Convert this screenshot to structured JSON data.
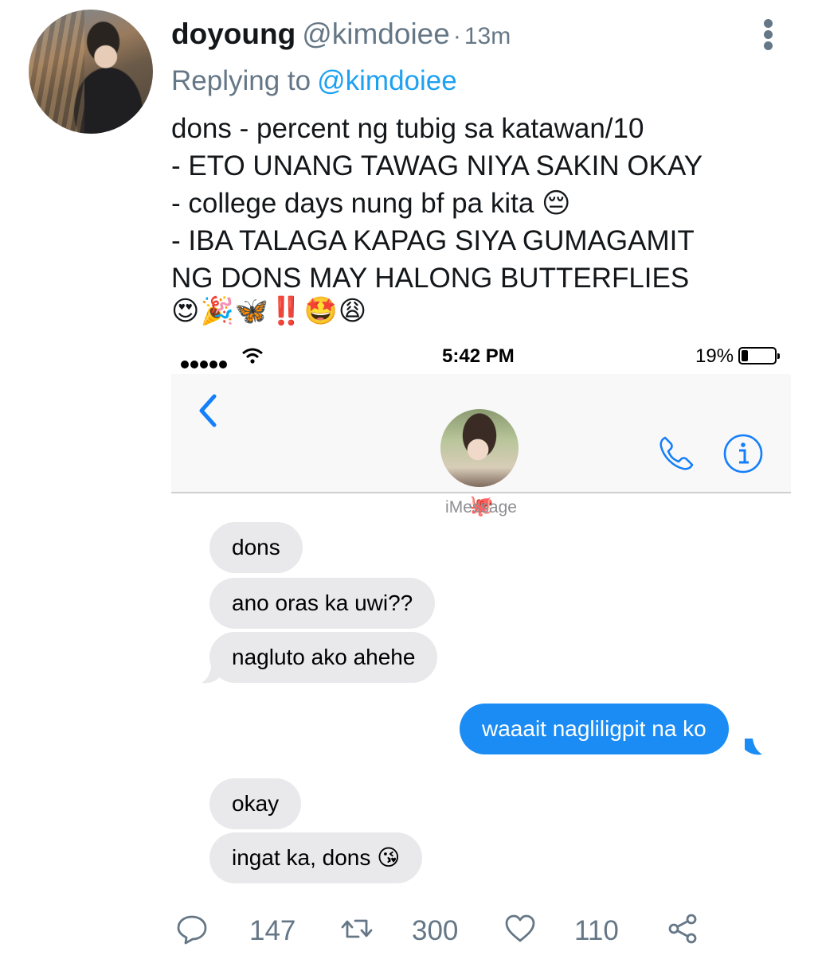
{
  "tweet": {
    "display_name": "doyoung",
    "handle": "@kimdoiee",
    "separator": "·",
    "time": "13m",
    "replying_to_label": "Replying to",
    "replying_to_handle": "@kimdoiee",
    "text_lines": [
      "dons - percent ng tubig sa katawan/10",
      "- ETO UNANG TAWAG NIYA SAKIN OKAY",
      "- college days nung bf pa kita 😔",
      "- IBA TALAGA KAPAG SIYA GUMAGAMIT",
      "NG DONS MAY HALONG BUTTERFLIES"
    ],
    "emoji_line": "😍🎉🦋‼️🤩😩",
    "icons": {
      "more": "more-vertical-icon"
    }
  },
  "screenshot": {
    "status_bar": {
      "time": "5:42 PM",
      "battery": "19%",
      "icons": [
        "signal-dots-icon",
        "wifi-icon",
        "battery-icon"
      ]
    },
    "contact_emoji": "🐙",
    "service_label": "iMessage",
    "messages": [
      {
        "direction": "in",
        "text": "dons"
      },
      {
        "direction": "in",
        "text": "ano oras ka uwi??"
      },
      {
        "direction": "in",
        "text": "nagluto ako ahehe"
      },
      {
        "direction": "out",
        "text": "waaait nagliligpit na ko"
      },
      {
        "direction": "in",
        "text": "okay"
      },
      {
        "direction": "in",
        "text": "ingat ka, dons 😘"
      }
    ],
    "colors": {
      "outgoing_bubble": "#1b8cf4",
      "incoming_bubble": "#e9e9eb",
      "ios_blue": "#147efb"
    }
  },
  "actions": {
    "replies": "147",
    "retweets": "300",
    "likes": "110",
    "icons": [
      "reply-icon",
      "retweet-icon",
      "like-icon",
      "share-icon"
    ]
  },
  "colors": {
    "twitter_blue": "#1da1f2",
    "secondary_text": "#657786"
  }
}
